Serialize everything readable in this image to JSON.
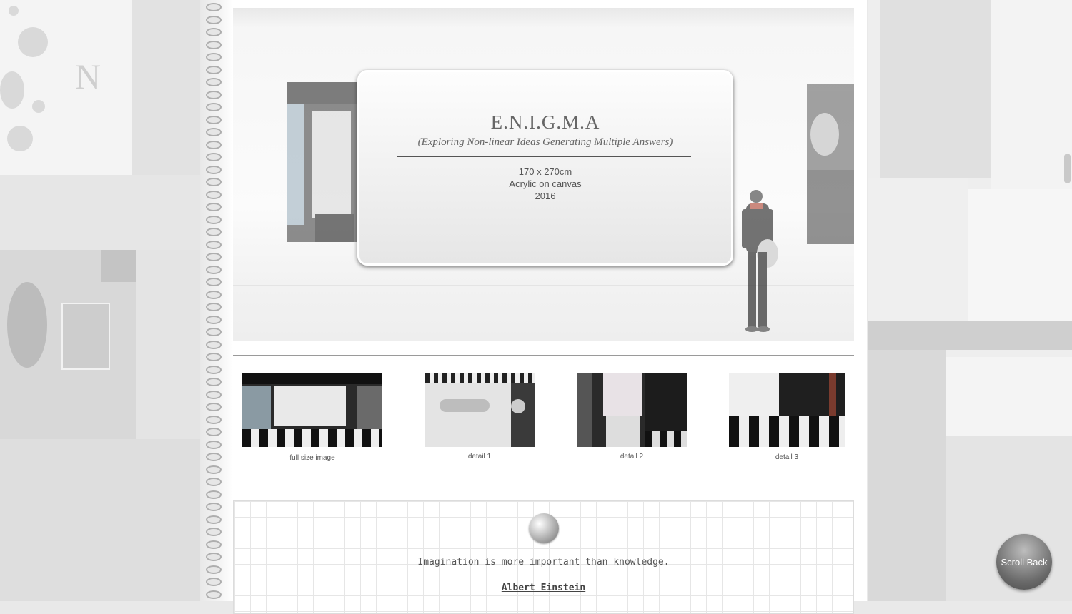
{
  "artwork": {
    "title": "E.N.I.G.M.A",
    "subtitle": "(Exploring Non-linear Ideas Generating Multiple Answers)",
    "dimensions": "170 x 270cm",
    "medium": "Acrylic on canvas",
    "year": "2016"
  },
  "thumbnails": [
    {
      "caption": "full size image"
    },
    {
      "caption": "detail 1"
    },
    {
      "caption": "detail 2"
    },
    {
      "caption": "detail 3"
    }
  ],
  "quote": {
    "text": "Imagination is more important than knowledge.",
    "author": "Albert Einstein"
  },
  "scroll_back_label": "Scroll Back",
  "background_letter": "N"
}
